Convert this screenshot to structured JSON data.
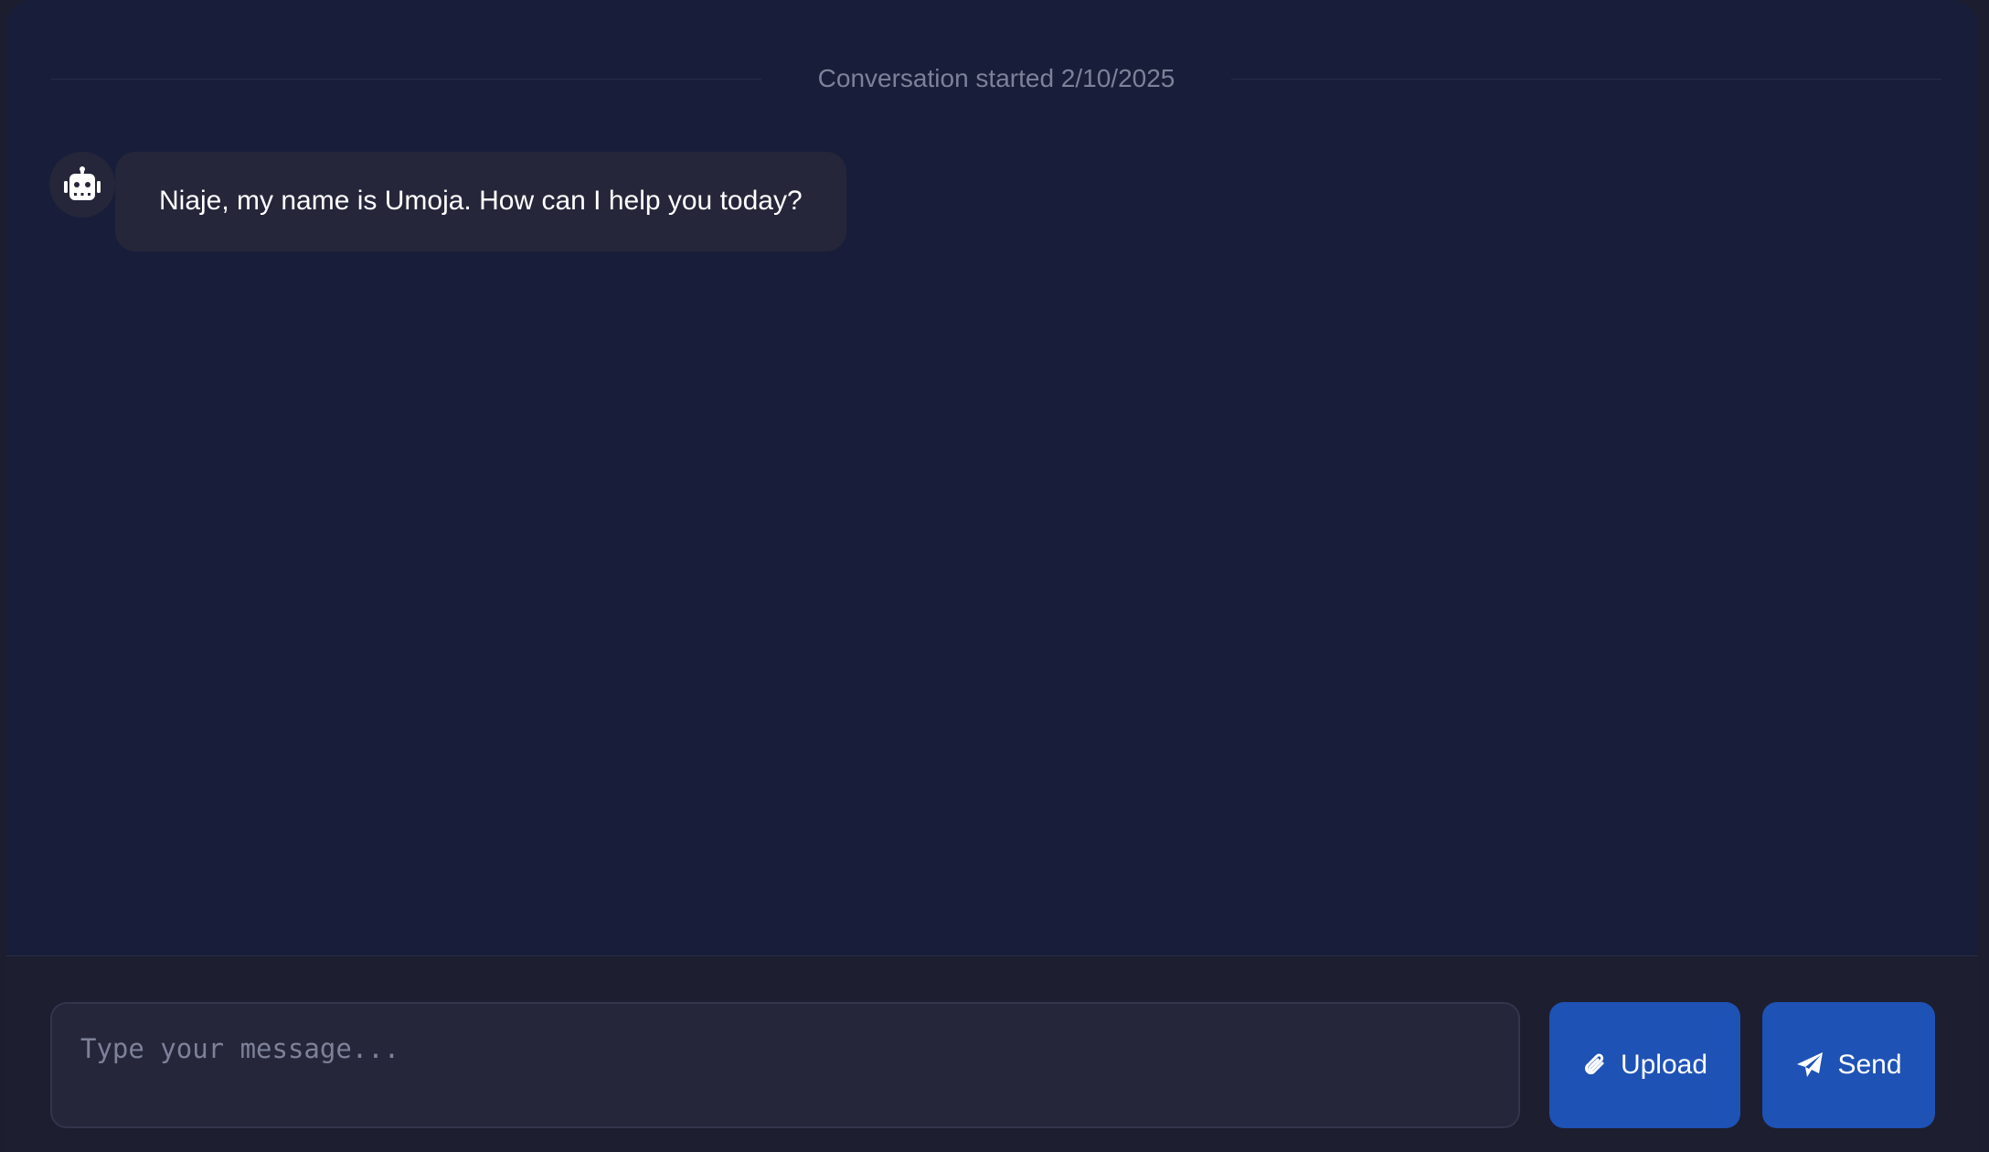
{
  "conversation": {
    "started_label": "Conversation started 2/10/2025"
  },
  "messages": [
    {
      "sender": "bot",
      "avatar_icon": "robot-icon",
      "text": "Niaje, my name is Umoja. How can I help you today?"
    }
  ],
  "composer": {
    "placeholder": "Type your message...",
    "value": "",
    "upload_label": "Upload",
    "upload_icon": "paperclip-icon",
    "send_label": "Send",
    "send_icon": "paper-plane-icon"
  },
  "colors": {
    "background": "#181e39",
    "bubble": "#25263a",
    "button": "#1e52b5",
    "muted_text": "#7d8199"
  }
}
